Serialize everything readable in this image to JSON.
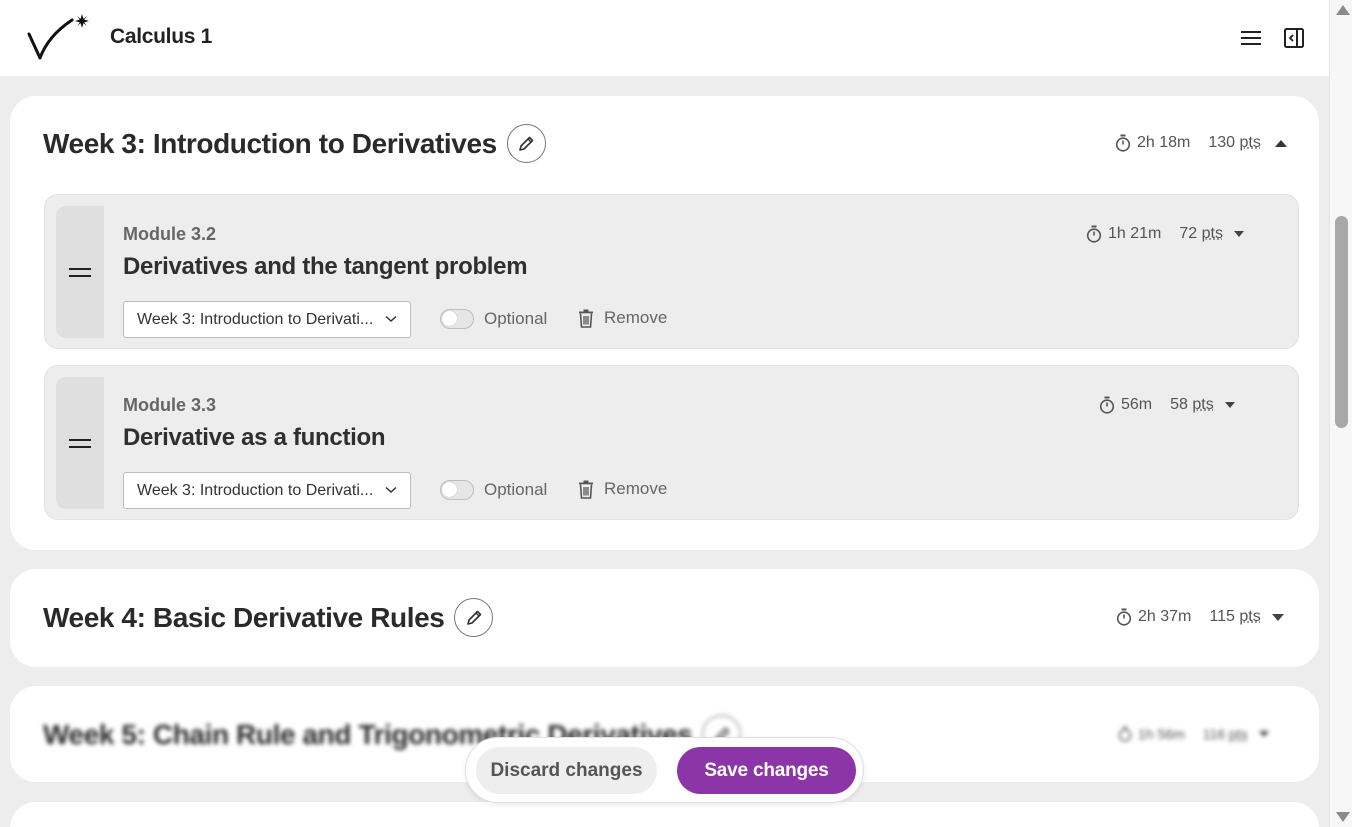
{
  "header": {
    "title": "Calculus 1",
    "logo_icon": "logo-check-star",
    "menu_icon": "hamburger-menu-icon",
    "panel_icon": "collapse-panel-icon"
  },
  "weeks": [
    {
      "title": "Week 3: Introduction to Derivatives",
      "time": "2h 18m",
      "points": "130",
      "points_unit": "pts",
      "expanded": true,
      "modules": [
        {
          "label": "Module 3.2",
          "title": "Derivatives and the tangent problem",
          "time": "1h 21m",
          "points": "72",
          "points_unit": "pts",
          "week_select": "Week 3: Introduction to Derivati...",
          "optional_label": "Optional",
          "optional_on": false,
          "remove_label": "Remove"
        },
        {
          "label": "Module 3.3",
          "title": "Derivative as a function",
          "time": "56m",
          "points": "58",
          "points_unit": "pts",
          "week_select": "Week 3: Introduction to Derivati...",
          "optional_label": "Optional",
          "optional_on": false,
          "remove_label": "Remove"
        }
      ]
    },
    {
      "title": "Week 4: Basic Derivative Rules",
      "time": "2h 37m",
      "points": "115",
      "points_unit": "pts",
      "expanded": false
    },
    {
      "title": "Week 5: Chain Rule and Trigonometric Derivatives",
      "time": "1h 56m",
      "points": "116",
      "points_unit": "pts",
      "expanded": false
    }
  ],
  "actions": {
    "discard_label": "Discard changes",
    "save_label": "Save changes"
  },
  "colors": {
    "accent": "#8c35a8",
    "page_bg": "#ededed",
    "card_bg": "#ffffff",
    "module_bg": "#ededed"
  }
}
